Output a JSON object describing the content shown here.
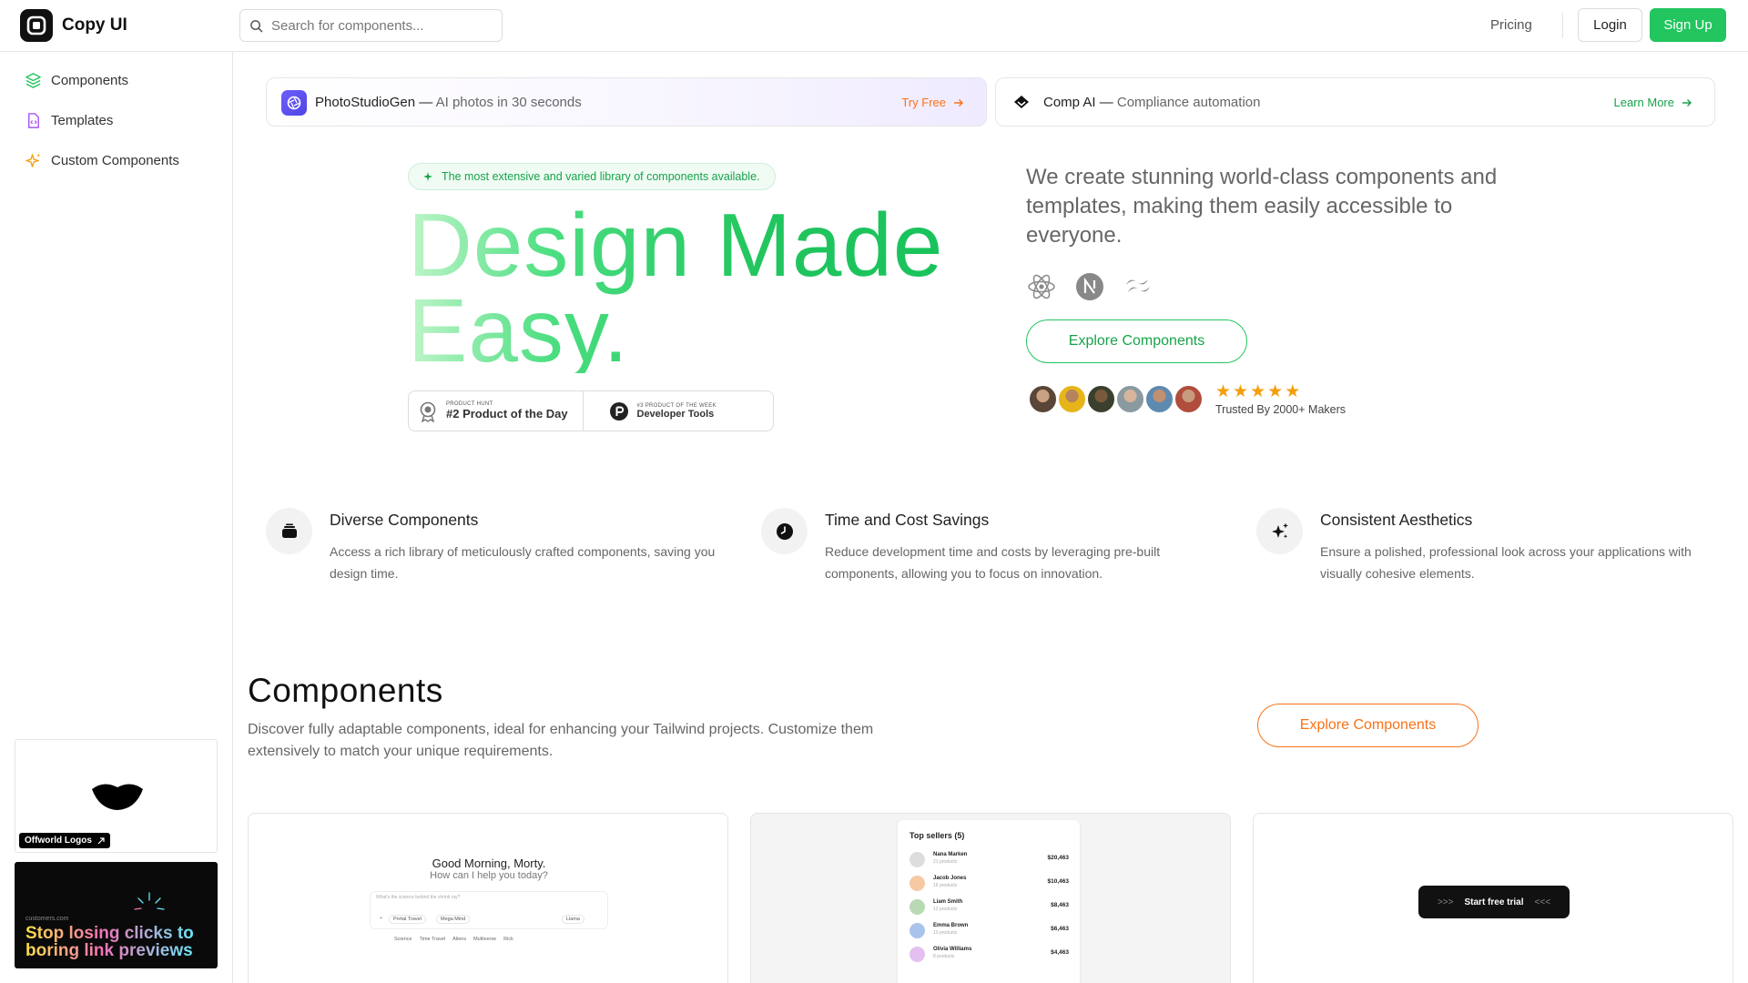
{
  "header": {
    "brand": "Copy UI",
    "search_placeholder": "Search for components...",
    "pricing": "Pricing",
    "login": "Login",
    "signup": "Sign Up"
  },
  "sidebar": {
    "items": [
      {
        "label": "Components",
        "icon": "layers-icon"
      },
      {
        "label": "Templates",
        "icon": "file-code-icon"
      },
      {
        "label": "Custom Components",
        "icon": "sparkles-icon"
      }
    ],
    "ad1": {
      "tag": "Offworld Logos"
    },
    "ad2": {
      "small": "customers.com",
      "headline_1": "Stop losing clicks to",
      "headline_2": "boring link previews"
    }
  },
  "promos": [
    {
      "title": "PhotoStudioGen",
      "subtitle": "AI photos in 30 seconds",
      "cta": "Try Free",
      "cta_color": "#f97316"
    },
    {
      "title": "Comp AI",
      "subtitle": "Compliance automation",
      "cta": "Learn More",
      "cta_color": "#16a34a"
    }
  ],
  "hero": {
    "badge": "The most extensive and varied library of components available.",
    "title_line1": "Design Made",
    "title_line2": "Easy.",
    "hunt": [
      {
        "small": "PRODUCT HUNT",
        "big": "#2 Product of the Day"
      },
      {
        "small": "#3 PRODUCT OF THE WEEK",
        "big": "Developer Tools"
      }
    ],
    "description": "We create stunning world-class components and templates, making them easily accessible to everyone.",
    "tech_icons": [
      "react-icon",
      "nextjs-icon",
      "tailwind-icon"
    ],
    "cta": "Explore Components",
    "rating": 5,
    "trusted": "Trusted By 2000+ Makers"
  },
  "features": [
    {
      "title": "Diverse Components",
      "desc": "Access a rich library of meticulously crafted components, saving you design time.",
      "icon": "stack-icon"
    },
    {
      "title": "Time and Cost Savings",
      "desc": "Reduce development time and costs by leveraging pre-built components, allowing you to focus on innovation.",
      "icon": "clock-icon"
    },
    {
      "title": "Consistent Aesthetics",
      "desc": "Ensure a polished, professional look across your applications with visually cohesive elements.",
      "icon": "sparkles-icon"
    }
  ],
  "components_section": {
    "heading": "Components",
    "desc": "Discover fully adaptable components, ideal for enhancing your Tailwind projects. Customize them extensively to match your unique requirements.",
    "cta": "Explore Components"
  },
  "cards": {
    "chat": {
      "greeting": "Good Morning, Morty.",
      "sub": "How can I help you today?",
      "placeholder": "What's the science behind the shrink ray?",
      "chip_1": "Portal Travel",
      "chip_2": "Mega Mind",
      "chip_3": "Llama",
      "suggestions": [
        "Science",
        "Time Travel",
        "Aliens",
        "Multiverse",
        "Rick"
      ]
    },
    "sellers": {
      "title": "Top sellers (5)",
      "rows": [
        {
          "name": "Nana Marken",
          "meta": "21 products",
          "amount": "$20,463"
        },
        {
          "name": "Jacob Jones",
          "meta": "16 products",
          "amount": "$10,463"
        },
        {
          "name": "Liam Smith",
          "meta": "12 products",
          "amount": "$8,463"
        },
        {
          "name": "Emma Brown",
          "meta": "10 products",
          "amount": "$6,463"
        },
        {
          "name": "Olivia Williams",
          "meta": "8 products",
          "amount": "$4,463"
        }
      ]
    },
    "trial": {
      "label": "Start free trial",
      "left_arrows": ">>>",
      "right_arrows": "<<<"
    }
  }
}
